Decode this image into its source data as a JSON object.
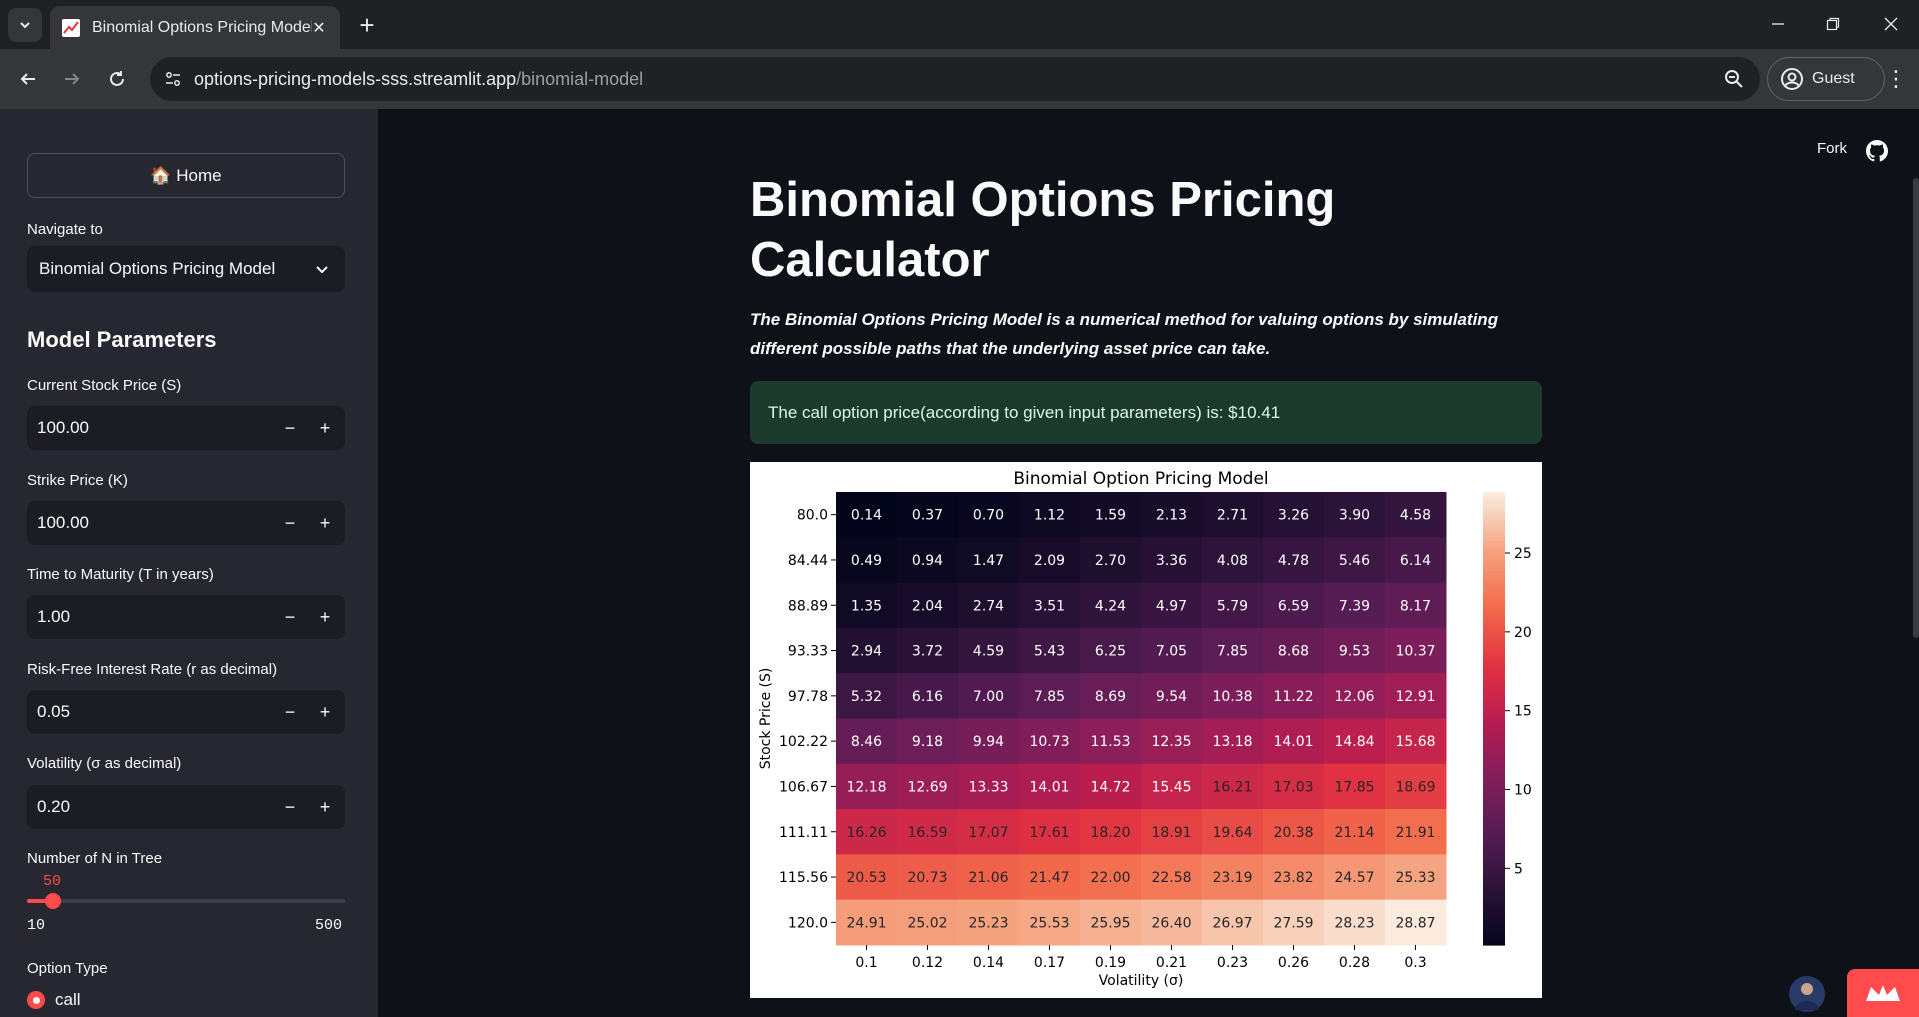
{
  "browser": {
    "tab_title": "Binomial Options Pricing Model",
    "url_host": "options-pricing-models-sss.streamlit.app",
    "url_path": "/binomial-model",
    "profile_label": "Guest"
  },
  "header": {
    "fork_label": "Fork"
  },
  "sidebar": {
    "home_label": "🏠 Home",
    "navigate_label": "Navigate to",
    "navigate_value": "Binomial Options Pricing Model",
    "section_title": "Model Parameters",
    "inputs": [
      {
        "label": "Current Stock Price (S)",
        "value": "100.00"
      },
      {
        "label": "Strike Price (K)",
        "value": "100.00"
      },
      {
        "label": "Time to Maturity (T in years)",
        "value": "1.00"
      },
      {
        "label": "Risk-Free Interest Rate (r as decimal)",
        "value": "0.05"
      },
      {
        "label": "Volatility (σ as decimal)",
        "value": "0.20"
      }
    ],
    "slider": {
      "label": "Number of N in Tree",
      "value": "50",
      "min": "10",
      "max": "500",
      "fraction": 0.0816
    },
    "option_type_label": "Option Type",
    "option_selected": "call"
  },
  "main": {
    "title": "Binomial Options Pricing Calculator",
    "intro": "The Binomial Options Pricing Model is a numerical method for valuing options by simulating different possible paths that the underlying asset price can take.",
    "result": "The call option price(according to given input parameters) is: $10.41"
  },
  "colors": {
    "accent": "#ff4b4b",
    "sidebar_bg": "#262730",
    "main_bg": "#0e1117",
    "success_bg": "#1b3a2c"
  },
  "chart_data": {
    "type": "heatmap",
    "title": "Binomial Option Pricing Model",
    "xlabel": "Volatility (σ)",
    "ylabel": "Stock Price (S)",
    "x": [
      "0.1",
      "0.12",
      "0.14",
      "0.17",
      "0.19",
      "0.21",
      "0.23",
      "0.26",
      "0.28",
      "0.3"
    ],
    "y": [
      "80.0",
      "84.44",
      "88.89",
      "93.33",
      "97.78",
      "102.22",
      "106.67",
      "111.11",
      "115.56",
      "120.0"
    ],
    "values": [
      [
        "0.14",
        "0.37",
        "0.70",
        "1.12",
        "1.59",
        "2.13",
        "2.71",
        "3.26",
        "3.90",
        "4.58"
      ],
      [
        "0.49",
        "0.94",
        "1.47",
        "2.09",
        "2.70",
        "3.36",
        "4.08",
        "4.78",
        "5.46",
        "6.14"
      ],
      [
        "1.35",
        "2.04",
        "2.74",
        "3.51",
        "4.24",
        "4.97",
        "5.79",
        "6.59",
        "7.39",
        "8.17"
      ],
      [
        "2.94",
        "3.72",
        "4.59",
        "5.43",
        "6.25",
        "7.05",
        "7.85",
        "8.68",
        "9.53",
        "10.37"
      ],
      [
        "5.32",
        "6.16",
        "7.00",
        "7.85",
        "8.69",
        "9.54",
        "10.38",
        "11.22",
        "12.06",
        "12.91"
      ],
      [
        "8.46",
        "9.18",
        "9.94",
        "10.73",
        "11.53",
        "12.35",
        "13.18",
        "14.01",
        "14.84",
        "15.68"
      ],
      [
        "12.18",
        "12.69",
        "13.33",
        "14.01",
        "14.72",
        "15.45",
        "16.21",
        "17.03",
        "17.85",
        "18.69"
      ],
      [
        "16.26",
        "16.59",
        "17.07",
        "17.61",
        "18.20",
        "18.91",
        "19.64",
        "20.38",
        "21.14",
        "21.91"
      ],
      [
        "20.53",
        "20.73",
        "21.06",
        "21.47",
        "22.00",
        "22.58",
        "23.19",
        "23.82",
        "24.57",
        "25.33"
      ],
      [
        "24.91",
        "25.02",
        "25.23",
        "25.53",
        "25.95",
        "26.40",
        "26.97",
        "27.59",
        "28.23",
        "28.87"
      ]
    ],
    "colorbar_ticks": [
      "5",
      "10",
      "15",
      "20",
      "25"
    ],
    "colorbar_range": [
      0.14,
      28.87
    ],
    "colormap": "rocket"
  }
}
